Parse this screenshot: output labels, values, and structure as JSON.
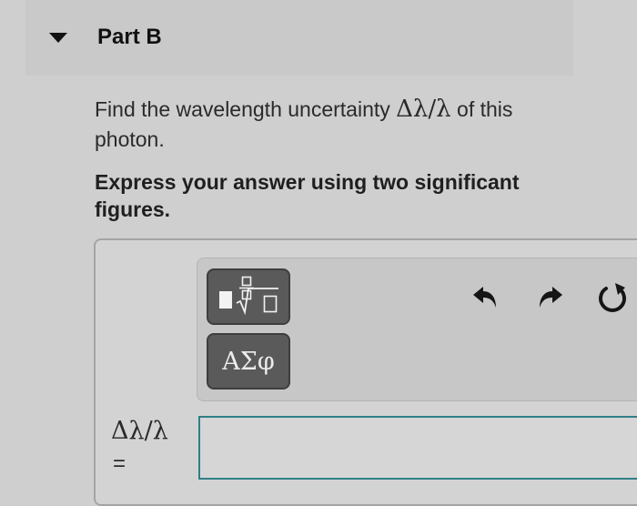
{
  "part": {
    "title": "Part B"
  },
  "question": {
    "text_before": "Find the wavelength uncertainty ",
    "expression": "Δλ/λ",
    "text_after": " of this photon."
  },
  "instruction": "Express your answer using two significant figures.",
  "toolbar": {
    "templates_button": {
      "icon": "fraction-sqrt-template-icon"
    },
    "symbols_button": {
      "label": "ΑΣφ"
    },
    "undo": {
      "icon": "undo-icon"
    },
    "redo": {
      "icon": "redo-icon"
    },
    "reset": {
      "icon": "reset-icon"
    }
  },
  "answer": {
    "variable": "Δλ/λ",
    "equals": "=",
    "value": ""
  },
  "colors": {
    "background": "#cfcfcf",
    "tool_button": "#5a5a5a",
    "input_border": "#2f7f86"
  }
}
